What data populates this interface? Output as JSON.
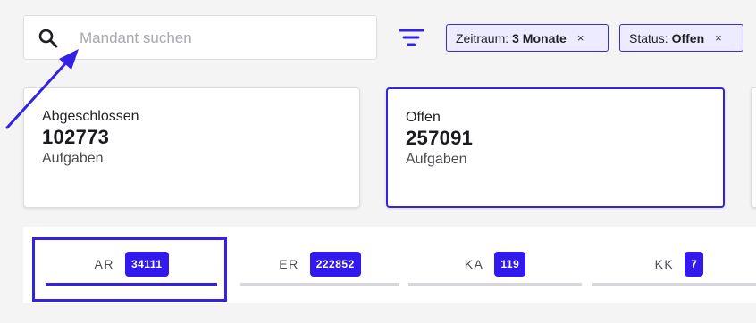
{
  "search": {
    "placeholder": "Mandant suchen",
    "value": ""
  },
  "filters": [
    {
      "key": "Zeitraum:",
      "value": "3 Monate",
      "close": "×"
    },
    {
      "key": "Status:",
      "value": "Offen",
      "close": "×"
    }
  ],
  "cards": [
    {
      "label": "Abgeschlossen",
      "value": "102773",
      "sub": "Aufgaben"
    },
    {
      "label": "Offen",
      "value": "257091",
      "sub": "Aufgaben"
    }
  ],
  "tabs": [
    {
      "label": "AR",
      "count": "34111"
    },
    {
      "label": "ER",
      "count": "222852"
    },
    {
      "label": "KA",
      "count": "119"
    },
    {
      "label": "KK",
      "count": "7"
    }
  ],
  "colors": {
    "accent": "#3322e6",
    "chip_bg": "#ecebff",
    "badge_bg": "#3219f0"
  },
  "icons": {
    "search": "search-icon",
    "filter": "filter-icon",
    "close": "close-icon",
    "arrow": "annotation-arrow"
  }
}
